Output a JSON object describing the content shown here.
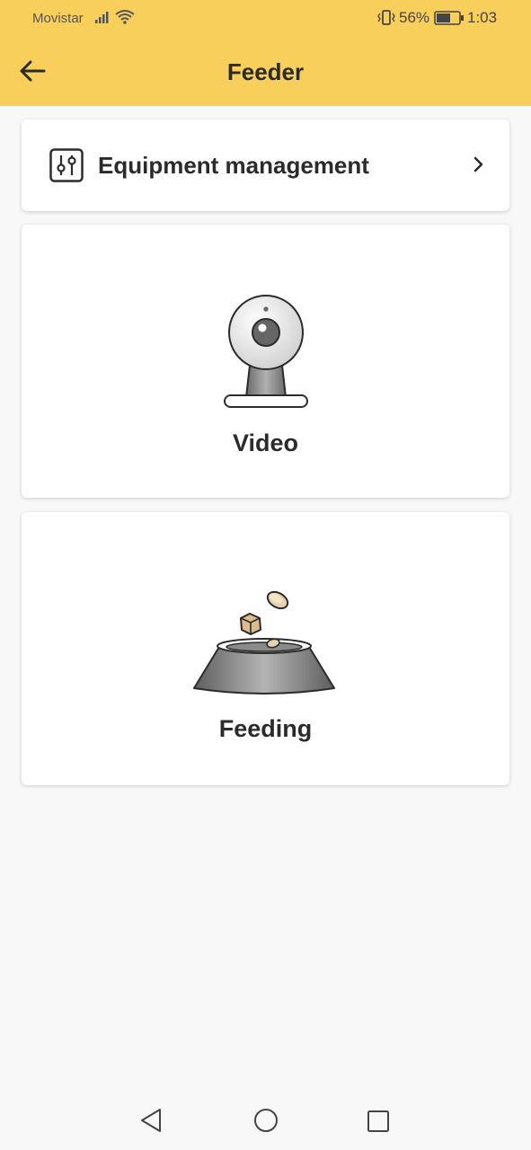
{
  "status_bar": {
    "carrier": "Movistar",
    "battery_percent": "56%",
    "time": "1:03",
    "icons": [
      "signal-icon",
      "wifi-icon",
      "vibrate-icon",
      "battery-icon"
    ]
  },
  "header": {
    "title": "Feeder",
    "back_icon": "back-arrow-icon",
    "background_color": "#f9cf5c"
  },
  "equipment": {
    "label": "Equipment management",
    "icon": "sliders-icon",
    "chevron_icon": "chevron-right-icon"
  },
  "cards": {
    "video": {
      "label": "Video",
      "icon": "webcam-icon"
    },
    "feeding": {
      "label": "Feeding",
      "icon": "food-bowl-icon"
    }
  },
  "system_nav": {
    "icons": [
      "nav-back-icon",
      "nav-home-icon",
      "nav-recents-icon"
    ]
  }
}
